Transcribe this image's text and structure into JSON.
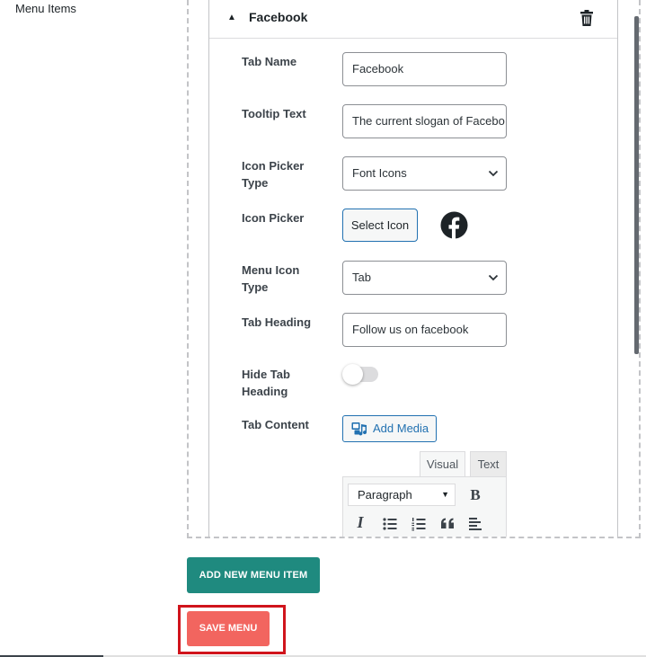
{
  "section_label": "Menu Items",
  "panel": {
    "title": "Facebook",
    "fields": {
      "tab_name": {
        "label": "Tab Name",
        "value": "Facebook"
      },
      "tooltip_text": {
        "label": "Tooltip Text",
        "value": "The current slogan of Facebo"
      },
      "icon_picker_type": {
        "label_1": "Icon Picker",
        "label_2": "Type",
        "selected": "Font Icons"
      },
      "icon_picker": {
        "label": "Icon Picker",
        "button": "Select Icon",
        "icon": "facebook-icon"
      },
      "menu_icon_type": {
        "label_1": "Menu Icon",
        "label_2": "Type",
        "selected": "Tab"
      },
      "tab_heading": {
        "label": "Tab Heading",
        "value": "Follow us on facebook"
      },
      "hide_tab_heading": {
        "label_1": "Hide Tab",
        "label_2": "Heading",
        "enabled": false
      },
      "tab_content": {
        "label": "Tab Content",
        "add_media": "Add Media"
      }
    },
    "editor": {
      "tabs": {
        "visual": "Visual",
        "text": "Text"
      },
      "format_select": "Paragraph",
      "bold": "B",
      "italic": "I",
      "toolbar_icons": [
        "bold-icon",
        "italic-icon",
        "bullet-list-icon",
        "numbered-list-icon",
        "blockquote-icon",
        "align-left-icon"
      ]
    }
  },
  "buttons": {
    "add_new_menu_item": "ADD NEW MENU ITEM",
    "save_menu": "SAVE MENU"
  },
  "colors": {
    "teal_button": "#1f8a7f",
    "save_button": "#f2655f",
    "highlight_outline": "#d0141c",
    "link_blue": "#2271b1"
  }
}
